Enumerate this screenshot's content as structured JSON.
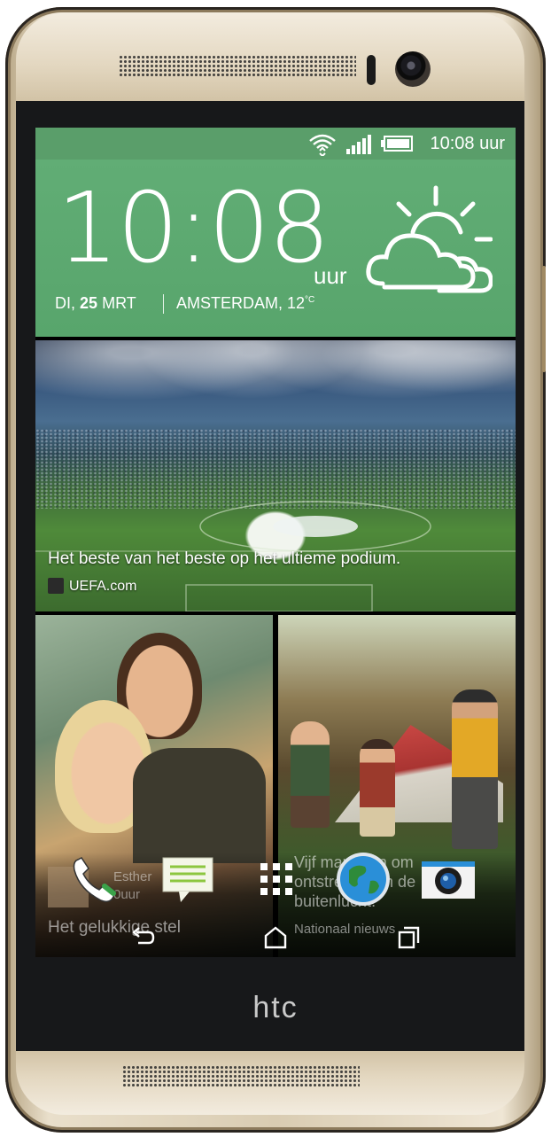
{
  "device": {
    "brand_logo": "htc"
  },
  "status_bar": {
    "time": "10:08 uur",
    "icons": [
      "wifi-icon",
      "signal-icon",
      "battery-icon"
    ]
  },
  "clock_widget": {
    "time": "10:08",
    "suffix": "uur",
    "day": "DI,",
    "date_num": "25",
    "month": "MRT",
    "location": "AMSTERDAM, 12",
    "temp_unit": "°C",
    "weather_icon": "partly-cloudy-icon"
  },
  "feed": {
    "hero": {
      "caption": "Het beste van het beste op het ultieme podium.",
      "source": "UEFA.com"
    },
    "tile_left": {
      "author": "Esther",
      "time": "0uur",
      "caption": "Het gelukkige stel"
    },
    "tile_right": {
      "caption_line1": "Vijf manieren om",
      "caption_line2": "ontstressen in de",
      "caption_line3": "buitenlucht.",
      "source": "Nationaal nieuws"
    }
  },
  "dock": {
    "items": [
      "phone-icon",
      "messages-icon",
      "app-drawer-icon",
      "internet-icon",
      "camera-icon"
    ]
  },
  "nav_bar": {
    "buttons": [
      "back-icon",
      "home-icon",
      "recent-apps-icon"
    ]
  },
  "colors": {
    "widget_green": "#5a9e6a",
    "phone_gold": "#d9ccb2",
    "bezel": "#17181a"
  }
}
